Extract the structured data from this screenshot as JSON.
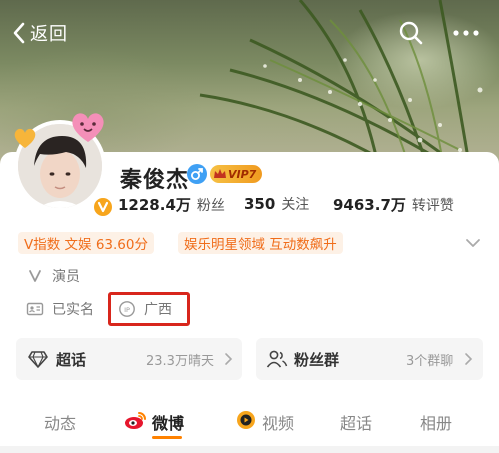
{
  "nav": {
    "back_label": "返回"
  },
  "profile": {
    "name": "秦俊杰",
    "vip_label": "VIP7",
    "stats": [
      {
        "value": "1228.4万",
        "label": "粉丝"
      },
      {
        "value": "350",
        "label": "关注"
      },
      {
        "value": "9463.7万",
        "label": "转评赞"
      }
    ],
    "tags": [
      {
        "text": "V指数 文娱 63.60分"
      },
      {
        "text": "娱乐明星领域 互动数飙升"
      }
    ],
    "occupation": "演员",
    "real_name_status": "已实名",
    "ip_location": "广西"
  },
  "entries": {
    "supertopic": {
      "title": "超话",
      "meta": "23.3万晴天"
    },
    "fan_group": {
      "title": "粉丝群",
      "meta": "3个群聊"
    }
  },
  "tabs": [
    {
      "label": "动态"
    },
    {
      "label": "微博"
    },
    {
      "label": "视频"
    },
    {
      "label": "超话"
    },
    {
      "label": "相册"
    }
  ],
  "colors": {
    "accent_orange": "#ff8200",
    "tag_text": "#f06d1a",
    "highlight_red": "#d8261c",
    "verified_gold": "#f7a51c"
  },
  "icons": [
    "chevron-left-icon",
    "search-icon",
    "more-icon",
    "gender-male-icon",
    "vip-crown-icon",
    "verified-v-icon",
    "chevron-down-icon",
    "occupation-v-icon",
    "id-card-icon",
    "ip-icon",
    "diamond-icon",
    "people-icon",
    "chevron-right-icon",
    "weibo-logo-icon",
    "video-play-icon"
  ]
}
